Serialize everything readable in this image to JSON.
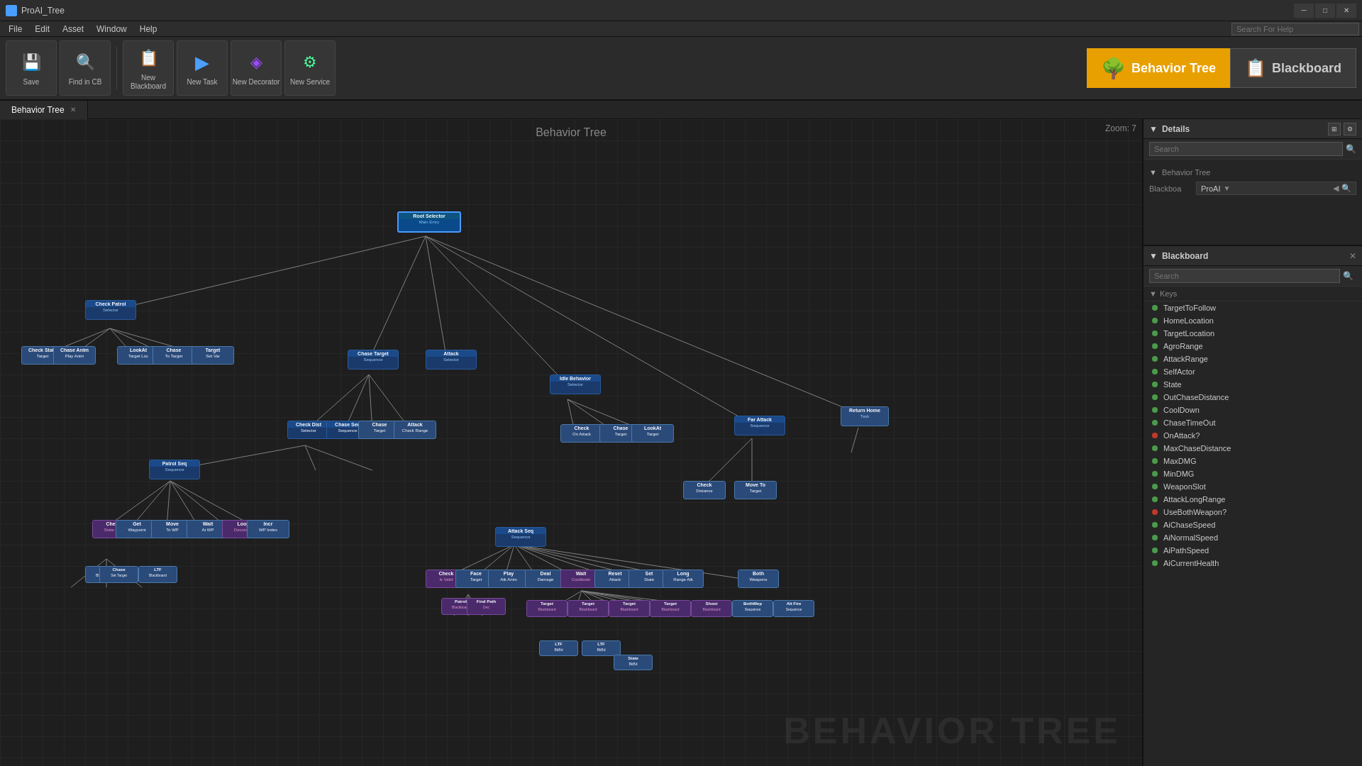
{
  "titlebar": {
    "title": "ProAI_Tree",
    "icon": "🌳",
    "controls": [
      "─",
      "□",
      "✕"
    ]
  },
  "menubar": {
    "items": [
      "File",
      "Edit",
      "Asset",
      "Window",
      "Help"
    ]
  },
  "search_for_help": {
    "placeholder": "Search For Help"
  },
  "toolbar": {
    "save_label": "Save",
    "find_in_cb_label": "Find in CB",
    "new_blackboard_label": "New Blackboard",
    "new_task_label": "New Task",
    "new_decorator_label": "New Decorator",
    "new_service_label": "New Service"
  },
  "view_switcher": {
    "behavior_tree_label": "Behavior Tree",
    "blackboard_label": "Blackboard"
  },
  "tab": {
    "label": "Behavior Tree",
    "active": true
  },
  "canvas": {
    "title": "Behavior Tree",
    "zoom": "Zoom: 7",
    "watermark": "BEHAVIOR TREE"
  },
  "details_panel": {
    "title": "Details",
    "search_placeholder": "Search",
    "behavior_tree_label": "Behavior Tree",
    "blackboa_label": "Blackboa",
    "proai_label": "ProAI"
  },
  "blackboard_panel": {
    "title": "Blackboard",
    "search_placeholder": "Search",
    "keys_label": "Keys",
    "keys": [
      {
        "name": "TargetToFollow",
        "color": "#4a9b4a"
      },
      {
        "name": "HomeLocation",
        "color": "#4a9b4a"
      },
      {
        "name": "TargetLocation",
        "color": "#4a9b4a"
      },
      {
        "name": "AgroRange",
        "color": "#4a9b4a"
      },
      {
        "name": "AttackRange",
        "color": "#4a9b4a"
      },
      {
        "name": "SelfActor",
        "color": "#4a9b4a"
      },
      {
        "name": "State",
        "color": "#4a9b4a"
      },
      {
        "name": "OutChaseDistance",
        "color": "#4a9b4a"
      },
      {
        "name": "CoolDown",
        "color": "#4a9b4a"
      },
      {
        "name": "ChaseTimeOut",
        "color": "#4a9b4a"
      },
      {
        "name": "OnAttack?",
        "color": "#c0392b"
      },
      {
        "name": "MaxChaseDistance",
        "color": "#4a9b4a"
      },
      {
        "name": "MaxDMG",
        "color": "#4a9b4a"
      },
      {
        "name": "MinDMG",
        "color": "#4a9b4a"
      },
      {
        "name": "WeaponSlot",
        "color": "#4a9b4a"
      },
      {
        "name": "AttackLongRange",
        "color": "#4a9b4a"
      },
      {
        "name": "UseBothWeapon?",
        "color": "#c0392b"
      },
      {
        "name": "AiChaseSpeed",
        "color": "#4a9b4a"
      },
      {
        "name": "AiNormalSpeed",
        "color": "#4a9b4a"
      },
      {
        "name": "AiPathSpeed",
        "color": "#4a9b4a"
      },
      {
        "name": "AiCurrentHealth",
        "color": "#4a9b4a"
      }
    ]
  },
  "icons": {
    "save": "💾",
    "find": "🔍",
    "blackboard": "📋",
    "task": "▶",
    "decorator": "◈",
    "service": "⚙",
    "behavior_tree_view": "🌳",
    "blackboard_view": "📋",
    "search": "🔍",
    "collapse": "▼",
    "expand": "▶"
  }
}
